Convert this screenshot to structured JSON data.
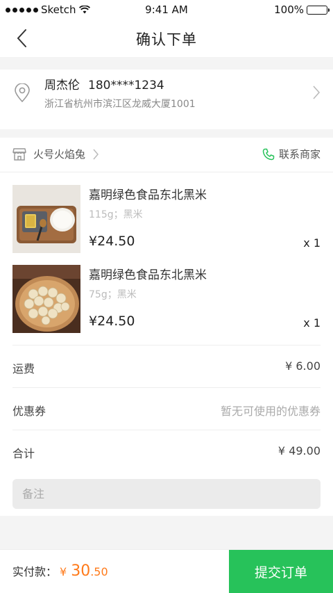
{
  "status_bar": {
    "carrier": "Sketch",
    "time": "9:41 AM",
    "battery": "100%"
  },
  "nav": {
    "title": "确认下单",
    "back_icon": "chevron-left-icon"
  },
  "address": {
    "name": "周杰伦",
    "phone": "180****1234",
    "detail": "浙江省杭州市滨江区龙威大厦1001"
  },
  "shop": {
    "name": "火号火焰兔",
    "contact_label": "联系商家"
  },
  "products": [
    {
      "name": "嘉明绿色食品东北黑米",
      "spec": "115g；黑米",
      "price": "¥24.50",
      "qty": "x 1"
    },
    {
      "name": "嘉明绿色食品东北黑米",
      "spec": "75g；黑米",
      "price": "¥24.50",
      "qty": "x 1"
    }
  ],
  "shipping": {
    "label": "运费",
    "value": "¥ 6.00"
  },
  "coupon": {
    "label": "优惠券",
    "value": "暂无可使用的优惠券"
  },
  "total": {
    "label": "合计",
    "value": "¥ 49.00"
  },
  "remark": {
    "placeholder": "备注"
  },
  "footer": {
    "pay_label": "实付款：",
    "currency": "¥",
    "amount_int": "30",
    "amount_dec": ".50",
    "submit_label": "提交订单"
  },
  "colors": {
    "accent": "#27c25a",
    "price": "#ff7a1a"
  }
}
